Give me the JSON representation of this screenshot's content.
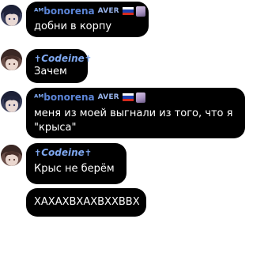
{
  "colors": {
    "bubble_bg": "#000000",
    "bubble_text": "#ffffff",
    "name_blue": "#5b84d6",
    "name_light_blue": "#7ea7ef",
    "page_bg": "#ffffff"
  },
  "messages": [
    {
      "sender_prefix": "ᴬᴹ",
      "sender": "bonorena",
      "tag": "AVER",
      "flag": "russia-flag-icon",
      "lines": [
        "добни в корпу"
      ]
    },
    {
      "sender_prefix": "✝",
      "sender": "Codeine",
      "sender_suffix": "✝",
      "lines": [
        "Зачем"
      ]
    },
    {
      "sender_prefix": "ᴬᴹ",
      "sender": "bonorena",
      "tag": "AVER",
      "flag": "russia-flag-icon",
      "lines": [
        "меня из моей выгнали из того, что я",
        "\"крыса\""
      ]
    },
    {
      "sender_prefix": "✝",
      "sender": "Codeine",
      "sender_suffix": "✝",
      "lines": [
        "Крыс не берём"
      ]
    },
    {
      "lines": [
        "ХАХАХВХАХВХХВВХ"
      ]
    }
  ]
}
